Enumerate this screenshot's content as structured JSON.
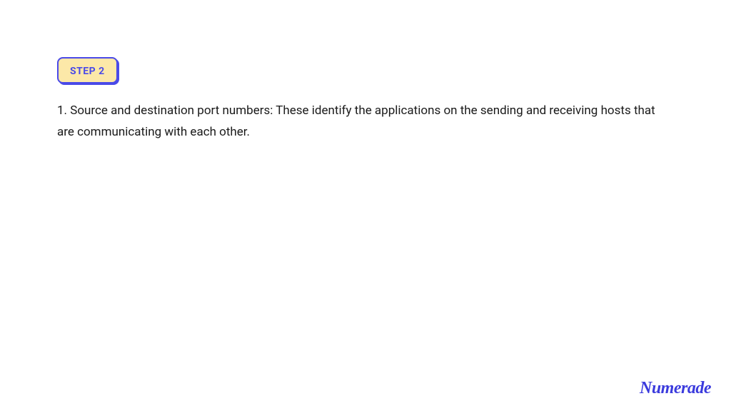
{
  "step": {
    "label": "STEP 2"
  },
  "body": {
    "text": "1. Source and destination port numbers: These identify the applications on the sending and receiving hosts that are communicating with each other."
  },
  "brand": {
    "name": "Numerade"
  }
}
